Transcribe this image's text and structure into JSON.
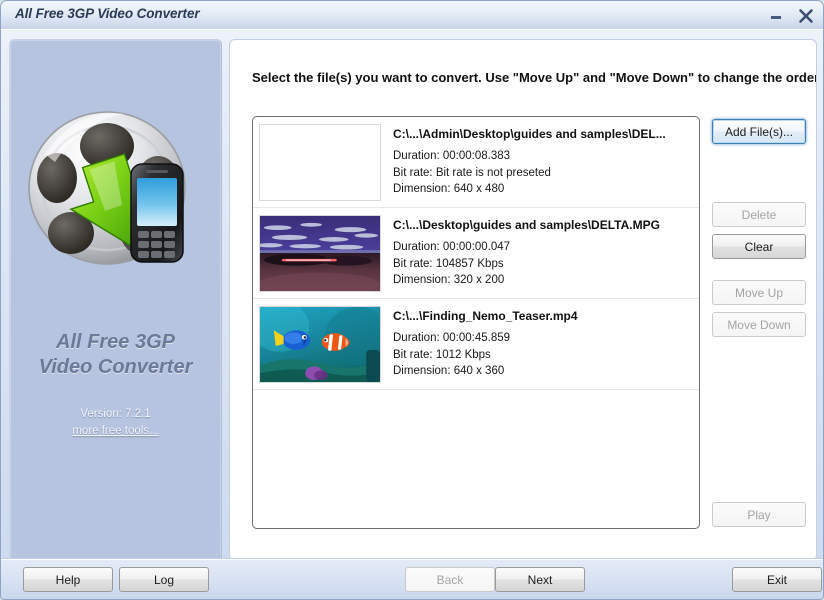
{
  "window": {
    "title": "All Free 3GP Video Converter",
    "minimize_icon": "minimize-icon",
    "close_icon": "close-icon"
  },
  "sidebar": {
    "logo_icon": "film-reel-phone-logo-icon",
    "app_name_line1": "All Free 3GP",
    "app_name_line2": "Video Converter",
    "version": "Version: 7.2.1",
    "more_tools_link": "more free tools..."
  },
  "main": {
    "instruction": "Select the file(s) you want to convert. Use \"Move Up\" and \"Move Down\" to change the order.",
    "files": [
      {
        "path": "C:\\...\\Admin\\Desktop\\guides and samples\\DEL...",
        "duration": "Duration: 00:00:08.383",
        "bitrate": "Bit rate: Bit rate is not preseted",
        "dimension": "Dimension: 640 x 480",
        "thumbnail": "blank-thumbnail"
      },
      {
        "path": "C:\\...\\Desktop\\guides and samples\\DELTA.MPG",
        "duration": "Duration: 00:00:00.047",
        "bitrate": "Bit rate: 104857 Kbps",
        "dimension": "Dimension: 320 x 200",
        "thumbnail": "dusk-landscape-thumbnail"
      },
      {
        "path": "C:\\...\\Finding_Nemo_Teaser.mp4",
        "duration": "Duration: 00:00:45.859",
        "bitrate": "Bit rate: 1012 Kbps",
        "dimension": "Dimension: 640 x 360",
        "thumbnail": "underwater-fish-thumbnail"
      }
    ]
  },
  "side_buttons": {
    "add_files": "Add File(s)...",
    "delete": "Delete",
    "clear": "Clear",
    "move_up": "Move Up",
    "move_down": "Move Down",
    "play": "Play"
  },
  "footer": {
    "help": "Help",
    "log": "Log",
    "back": "Back",
    "next": "Next",
    "exit": "Exit"
  },
  "colors": {
    "sidebar_bg": "#b6c4e0",
    "titlebar_top": "#f4f7fc",
    "panel_bg": "#ffffff",
    "focus_accent": "#3c7fb1",
    "app_name_text": "#6b7a96",
    "link_text": "#f2f5fb"
  }
}
